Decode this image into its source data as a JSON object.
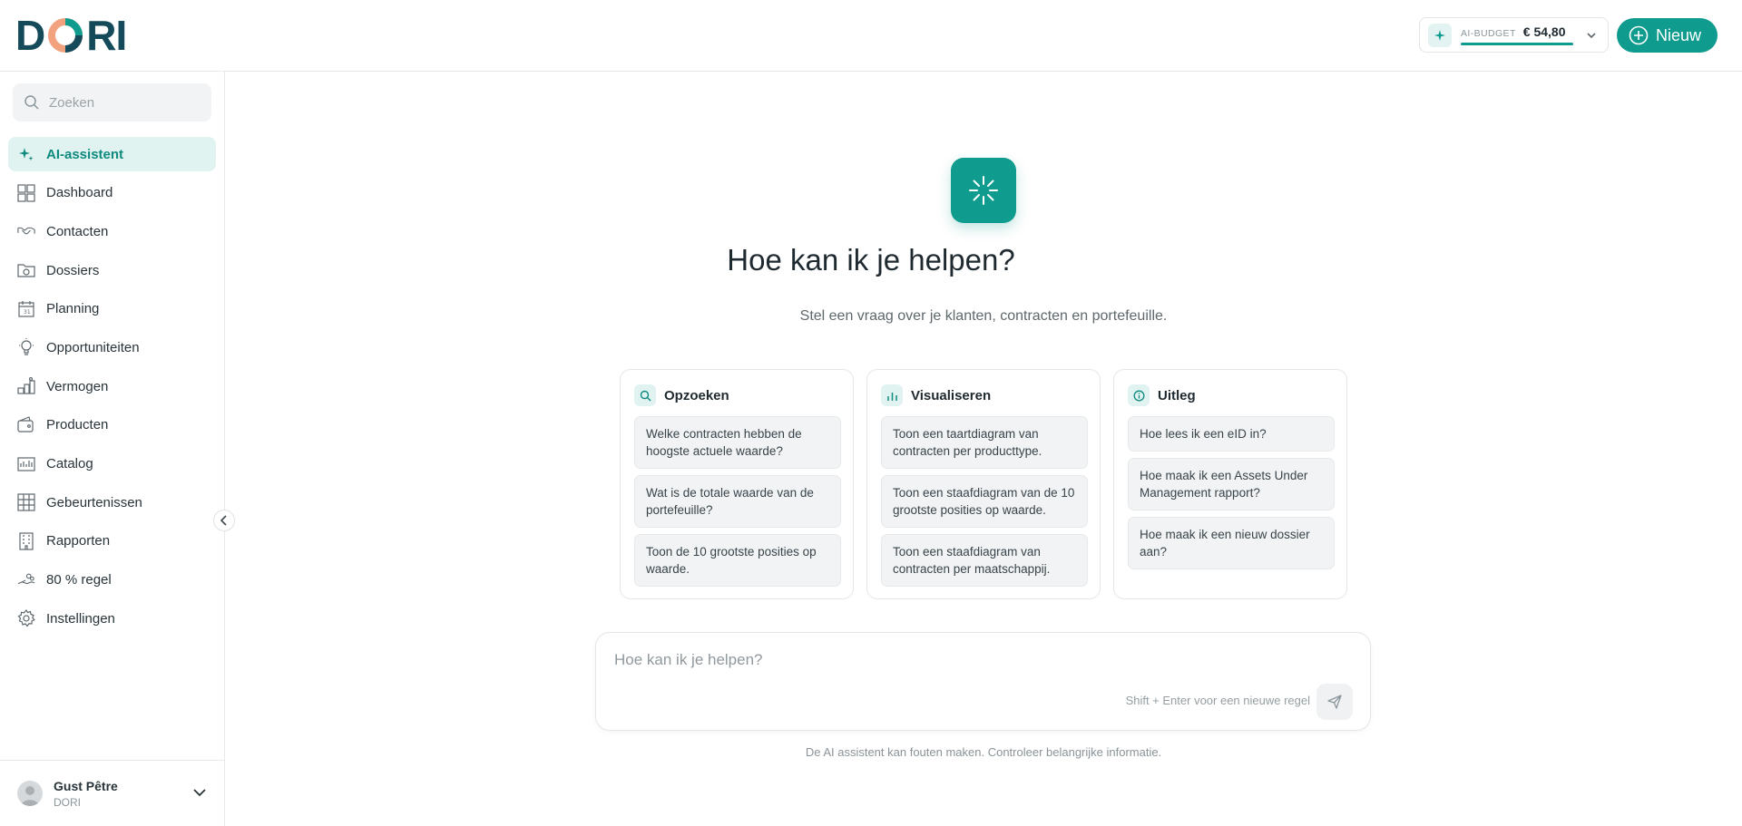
{
  "header": {
    "logo": {
      "letter_d": "D",
      "letters_ri": "RI",
      "text": "DORI"
    },
    "budget": {
      "label": "AI-BUDGET",
      "value": "€ 54,80"
    },
    "new_button": "Nieuw"
  },
  "sidebar": {
    "search": {
      "placeholder": "Zoeken"
    },
    "items": [
      {
        "label": "AI-assistent",
        "icon": "sparkle-icon",
        "active": true
      },
      {
        "label": "Dashboard",
        "icon": "dashboard-icon"
      },
      {
        "label": "Contacten",
        "icon": "handshake-icon"
      },
      {
        "label": "Dossiers",
        "icon": "folder-icon"
      },
      {
        "label": "Planning",
        "icon": "calendar-icon"
      },
      {
        "label": "Opportuniteiten",
        "icon": "lightbulb-icon"
      },
      {
        "label": "Vermogen",
        "icon": "wealth-icon"
      },
      {
        "label": "Producten",
        "icon": "wallet-icon"
      },
      {
        "label": "Catalog",
        "icon": "catalog-icon"
      },
      {
        "label": "Gebeurtenissen",
        "icon": "events-icon"
      },
      {
        "label": "Rapporten",
        "icon": "building-icon"
      },
      {
        "label": "80 % regel",
        "icon": "hand-coins-icon"
      },
      {
        "label": "Instellingen",
        "icon": "gear-icon"
      }
    ],
    "user": {
      "name": "Gust Pêtre",
      "org": "DORI"
    }
  },
  "main": {
    "title": "Hoe kan ik je helpen?",
    "subtitle": "Stel een vraag over je klanten, contracten en portefeuille.",
    "cards": [
      {
        "title": "Opzoeken",
        "icon": "search-icon",
        "prompts": [
          "Welke contracten hebben de hoogste actuele waarde?",
          "Wat is de totale waarde van de portefeuille?",
          "Toon de 10 grootste posities op waarde."
        ]
      },
      {
        "title": "Visualiseren",
        "icon": "bar-chart-icon",
        "prompts": [
          "Toon een taartdiagram van contracten per producttype.",
          "Toon een staafdiagram van de 10 grootste posities op waarde.",
          "Toon een staafdiagram van contracten per maatschappij."
        ]
      },
      {
        "title": "Uitleg",
        "icon": "info-icon",
        "prompts": [
          "Hoe lees ik een eID in?",
          "Hoe maak ik een Assets Under Management rapport?",
          "Hoe maak ik een nieuw dossier aan?"
        ]
      }
    ],
    "composer": {
      "placeholder": "Hoe kan ik je helpen?",
      "hint": "Shift + Enter voor een nieuwe regel"
    },
    "disclaimer": "De AI assistent kan fouten maken. Controleer belangrijke informatie."
  },
  "colors": {
    "accent": "#0f9b8e",
    "brand_dark": "#154a5a",
    "active_bg": "#e1f3f1"
  }
}
